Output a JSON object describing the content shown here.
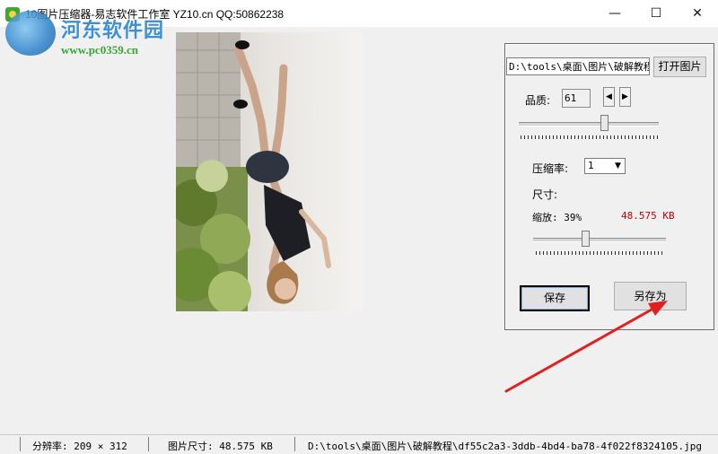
{
  "window": {
    "title": "10图片压缩器-易志软件工作室 YZ10.cn   QQ:50862238",
    "minimize_glyph": "—",
    "maximize_glyph": "☐",
    "close_glyph": "✕"
  },
  "watermark": {
    "site_name": "河东软件园",
    "url": "www.pc0359.cn"
  },
  "image": {
    "description_icon": "photo-preview"
  },
  "panel": {
    "path_value": "D:\\tools\\桌面\\图片\\破解教程",
    "open_button": "打开图片",
    "quality_label": "品质:",
    "quality_value": "61",
    "quality_slider_level": 0.61,
    "compress_label": "压缩率:",
    "compress_value": "1",
    "size_label": "尺寸:",
    "zoom_label": "缩放: 39%",
    "file_size": "48.575 KB",
    "zoom_slider_level": 0.39,
    "save_button": "保存",
    "save_as_button": "另存为"
  },
  "status": {
    "resolution": "分辨率: 209 × 312",
    "image_size": "图片尺寸: 48.575 KB",
    "path": "D:\\tools\\桌面\\图片\\破解教程\\df55c2a3-3ddb-4bd4-ba78-4f022f8324105.jpg"
  },
  "colors": {
    "annotation_arrow": "#e02020",
    "file_size_text": "#c00000",
    "watermark_blue": "#3d8fd6",
    "watermark_green": "#3aa536"
  }
}
